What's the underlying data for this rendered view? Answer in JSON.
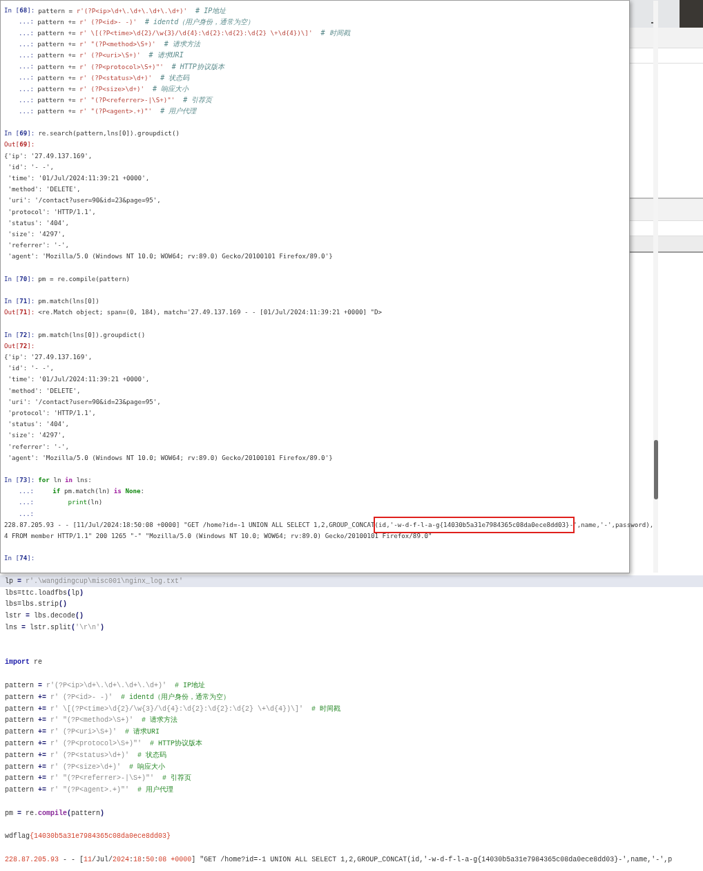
{
  "console": {
    "lines": [
      {
        "kind": "code",
        "prompt": {
          "kind": "in",
          "text": "In [**68**]:"
        },
        "segs": [
          {
            "kind": "plain",
            "text": "pattern = "
          },
          {
            "kind": "string",
            "text": "r'(?P<ip>\\d+\\.\\d+\\.\\d+\\.\\d+)'"
          },
          {
            "kind": "comment",
            "text": "  # IP地址"
          }
        ]
      },
      {
        "kind": "code",
        "prompt": {
          "kind": "cont",
          "text": "...:"
        },
        "segs": [
          {
            "kind": "plain",
            "text": "pattern += "
          },
          {
            "kind": "string",
            "text": "r' (?P<id>- -)'"
          },
          {
            "kind": "comment",
            "text": "  # identd（用户身份，通常为空）"
          }
        ]
      },
      {
        "kind": "code",
        "prompt": {
          "kind": "cont",
          "text": "...:"
        },
        "segs": [
          {
            "kind": "plain",
            "text": "pattern += "
          },
          {
            "kind": "string",
            "text": "r' \\[(?P<time>\\d{2}/\\w{3}/\\d{4}:\\d{2}:\\d{2}:\\d{2} \\+\\d{4})\\]'"
          },
          {
            "kind": "comment",
            "text": "  # 时间戳"
          }
        ]
      },
      {
        "kind": "code",
        "prompt": {
          "kind": "cont",
          "text": "...:"
        },
        "segs": [
          {
            "kind": "plain",
            "text": "pattern += "
          },
          {
            "kind": "string",
            "text": "r' \"(?P<method>\\S+)'"
          },
          {
            "kind": "comment",
            "text": "  # 请求方法"
          }
        ]
      },
      {
        "kind": "code",
        "prompt": {
          "kind": "cont",
          "text": "...:"
        },
        "segs": [
          {
            "kind": "plain",
            "text": "pattern += "
          },
          {
            "kind": "string",
            "text": "r' (?P<uri>\\S+)'"
          },
          {
            "kind": "comment",
            "text": "  # 请求URI"
          }
        ]
      },
      {
        "kind": "code",
        "prompt": {
          "kind": "cont",
          "text": "...:"
        },
        "segs": [
          {
            "kind": "plain",
            "text": "pattern += "
          },
          {
            "kind": "string",
            "text": "r' (?P<protocol>\\S+)\"'"
          },
          {
            "kind": "comment",
            "text": "  # HTTP协议版本"
          }
        ]
      },
      {
        "kind": "code",
        "prompt": {
          "kind": "cont",
          "text": "...:"
        },
        "segs": [
          {
            "kind": "plain",
            "text": "pattern += "
          },
          {
            "kind": "string",
            "text": "r' (?P<status>\\d+)'"
          },
          {
            "kind": "comment",
            "text": "  # 状态码"
          }
        ]
      },
      {
        "kind": "code",
        "prompt": {
          "kind": "cont",
          "text": "...:"
        },
        "segs": [
          {
            "kind": "plain",
            "text": "pattern += "
          },
          {
            "kind": "string",
            "text": "r' (?P<size>\\d+)'"
          },
          {
            "kind": "comment",
            "text": "  # 响应大小"
          }
        ]
      },
      {
        "kind": "code",
        "prompt": {
          "kind": "cont",
          "text": "...:"
        },
        "segs": [
          {
            "kind": "plain",
            "text": "pattern += "
          },
          {
            "kind": "string",
            "text": "r' \"(?P<referrer>-|\\S+)\"'"
          },
          {
            "kind": "comment",
            "text": "  # 引荐页"
          }
        ]
      },
      {
        "kind": "code",
        "prompt": {
          "kind": "cont",
          "text": "...:"
        },
        "segs": [
          {
            "kind": "plain",
            "text": "pattern += "
          },
          {
            "kind": "string",
            "text": "r' \"(?P<agent>.+)\"'"
          },
          {
            "kind": "comment",
            "text": "  # 用户代理"
          }
        ]
      },
      {
        "kind": "blank"
      },
      {
        "kind": "code",
        "prompt": {
          "kind": "in",
          "text": "In [**69**]:"
        },
        "segs": [
          {
            "kind": "plain",
            "text": "re.search(pattern,lns[0]).groupdict()"
          }
        ]
      },
      {
        "kind": "code",
        "prompt": {
          "kind": "out",
          "text": "Out[**69**]:"
        }
      },
      {
        "kind": "code",
        "segs": [
          {
            "kind": "plain",
            "text": "{'ip': '27.49.137.169',"
          }
        ]
      },
      {
        "kind": "code",
        "segs": [
          {
            "kind": "plain",
            "text": " 'id': '- -',"
          }
        ]
      },
      {
        "kind": "code",
        "segs": [
          {
            "kind": "plain",
            "text": " 'time': '01/Jul/2024:11:39:21 +0000',"
          }
        ]
      },
      {
        "kind": "code",
        "segs": [
          {
            "kind": "plain",
            "text": " 'method': 'DELETE',"
          }
        ]
      },
      {
        "kind": "code",
        "segs": [
          {
            "kind": "plain",
            "text": " 'uri': '/contact?user=90&id=23&page=95',"
          }
        ]
      },
      {
        "kind": "code",
        "segs": [
          {
            "kind": "plain",
            "text": " 'protocol': 'HTTP/1.1',"
          }
        ]
      },
      {
        "kind": "code",
        "segs": [
          {
            "kind": "plain",
            "text": " 'status': '404',"
          }
        ]
      },
      {
        "kind": "code",
        "segs": [
          {
            "kind": "plain",
            "text": " 'size': '4297',"
          }
        ]
      },
      {
        "kind": "code",
        "segs": [
          {
            "kind": "plain",
            "text": " 'referrer': '-',"
          }
        ]
      },
      {
        "kind": "code",
        "segs": [
          {
            "kind": "plain",
            "text": " 'agent': 'Mozilla/5.0 (Windows NT 10.0; WOW64; rv:89.0) Gecko/20100101 Firefox/89.0'}"
          }
        ]
      },
      {
        "kind": "blank"
      },
      {
        "kind": "code",
        "prompt": {
          "kind": "in",
          "text": "In [**70**]:"
        },
        "segs": [
          {
            "kind": "plain",
            "text": "pm = re.compile(pattern)"
          }
        ]
      },
      {
        "kind": "blank"
      },
      {
        "kind": "code",
        "prompt": {
          "kind": "in",
          "text": "In [**71**]:"
        },
        "segs": [
          {
            "kind": "plain",
            "text": "pm.match(lns[0])"
          }
        ]
      },
      {
        "kind": "code",
        "prompt": {
          "kind": "out",
          "text": "Out[**71**]:"
        },
        "segs": [
          {
            "kind": "plain",
            "text": "<re.Match object; span=(0, 184), match='27.49.137.169 - - [01/Jul/2024:11:39:21 +0000] \"D>"
          }
        ]
      },
      {
        "kind": "blank"
      },
      {
        "kind": "code",
        "prompt": {
          "kind": "in",
          "text": "In [**72**]:"
        },
        "segs": [
          {
            "kind": "plain",
            "text": "pm.match(lns[0]).groupdict()"
          }
        ]
      },
      {
        "kind": "code",
        "prompt": {
          "kind": "out",
          "text": "Out[**72**]:"
        }
      },
      {
        "kind": "code",
        "segs": [
          {
            "kind": "plain",
            "text": "{'ip': '27.49.137.169',"
          }
        ]
      },
      {
        "kind": "code",
        "segs": [
          {
            "kind": "plain",
            "text": " 'id': '- -',"
          }
        ]
      },
      {
        "kind": "code",
        "segs": [
          {
            "kind": "plain",
            "text": " 'time': '01/Jul/2024:11:39:21 +0000',"
          }
        ]
      },
      {
        "kind": "code",
        "segs": [
          {
            "kind": "plain",
            "text": " 'method': 'DELETE',"
          }
        ]
      },
      {
        "kind": "code",
        "segs": [
          {
            "kind": "plain",
            "text": " 'uri': '/contact?user=90&id=23&page=95',"
          }
        ]
      },
      {
        "kind": "code",
        "segs": [
          {
            "kind": "plain",
            "text": " 'protocol': 'HTTP/1.1',"
          }
        ]
      },
      {
        "kind": "code",
        "segs": [
          {
            "kind": "plain",
            "text": " 'status': '404',"
          }
        ]
      },
      {
        "kind": "code",
        "segs": [
          {
            "kind": "plain",
            "text": " 'size': '4297',"
          }
        ]
      },
      {
        "kind": "code",
        "segs": [
          {
            "kind": "plain",
            "text": " 'referrer': '-',"
          }
        ]
      },
      {
        "kind": "code",
        "segs": [
          {
            "kind": "plain",
            "text": " 'agent': 'Mozilla/5.0 (Windows NT 10.0; WOW64; rv:89.0) Gecko/20100101 Firefox/89.0'}"
          }
        ]
      },
      {
        "kind": "blank"
      },
      {
        "kind": "code",
        "prompt": {
          "kind": "in",
          "text": "In [**73**]:"
        },
        "segs": [
          {
            "kind": "keyword",
            "text": "for"
          },
          {
            "kind": "plain",
            "text": " ln "
          },
          {
            "kind": "keyword2",
            "text": "in"
          },
          {
            "kind": "plain",
            "text": " lns:"
          }
        ]
      },
      {
        "kind": "code",
        "prompt": {
          "kind": "cont",
          "text": "...:"
        },
        "segs": [
          {
            "kind": "keyword",
            "text": "    if"
          },
          {
            "kind": "plain",
            "text": " pm.match(ln) "
          },
          {
            "kind": "keyword2",
            "text": "is"
          },
          {
            "kind": "keyword",
            "text": " None"
          },
          {
            "kind": "plain",
            "text": ":"
          }
        ]
      },
      {
        "kind": "code",
        "prompt": {
          "kind": "cont",
          "text": "...:"
        },
        "segs": [
          {
            "kind": "builtin",
            "text": "        print"
          },
          {
            "kind": "plain",
            "text": "(ln)"
          }
        ]
      },
      {
        "kind": "code",
        "prompt": {
          "kind": "cont",
          "text": "...:"
        }
      },
      {
        "kind": "code",
        "segs": [
          {
            "kind": "plain",
            "text": "228.87.205.93 - - [11/Jul/2024:18:50:08 +0000] \"GET /home?id=-1 UNION ALL SELECT 1,2,GROUP_CONCAT"
          },
          {
            "kind": "highlight",
            "text": "(id,'-w-d-f-l-a-g{14030b5a31e7984365c08da0ece8dd03}-"
          },
          {
            "kind": "plain",
            "text": "',name,'-',password),"
          }
        ]
      },
      {
        "kind": "code",
        "segs": [
          {
            "kind": "plain",
            "text": "4 FROM member HTTP/1.1\" 200 1265 \"-\" \"Mozilla/5.0 (Windows NT 10.0; WOW64; rv:89.0) Gecko/20100101 Firefox/89.0\""
          }
        ]
      },
      {
        "kind": "blank"
      },
      {
        "kind": "code",
        "prompt": {
          "kind": "in",
          "text": "In [**74**]:"
        }
      }
    ]
  },
  "editor": {
    "lines": [
      {
        "kind": "code",
        "current": true,
        "segs": [
          {
            "kind": "plain",
            "text": "lp "
          },
          {
            "kind": "op",
            "text": "="
          },
          {
            "kind": "string",
            "text": " r'.\\wangdingcup\\misc001\\nginx_log.txt'"
          }
        ]
      },
      {
        "kind": "code",
        "current": false,
        "segs": [
          {
            "kind": "plain",
            "text": "lbs=ttc.loadfbs"
          },
          {
            "kind": "op",
            "text": "("
          },
          {
            "kind": "plain",
            "text": "lp"
          },
          {
            "kind": "op",
            "text": ")"
          }
        ]
      },
      {
        "kind": "code",
        "current": false,
        "segs": [
          {
            "kind": "plain",
            "text": "lbs=lbs.strip"
          },
          {
            "kind": "op",
            "text": "()"
          }
        ]
      },
      {
        "kind": "code",
        "current": false,
        "segs": [
          {
            "kind": "plain",
            "text": "lstr "
          },
          {
            "kind": "op",
            "text": "="
          },
          {
            "kind": "plain",
            "text": " lbs.decode"
          },
          {
            "kind": "op",
            "text": "()"
          }
        ]
      },
      {
        "kind": "code",
        "current": false,
        "segs": [
          {
            "kind": "plain",
            "text": "lns "
          },
          {
            "kind": "op",
            "text": "="
          },
          {
            "kind": "plain",
            "text": " lstr.split"
          },
          {
            "kind": "op",
            "text": "("
          },
          {
            "kind": "string",
            "text": "'\\r\\n'"
          },
          {
            "kind": "op",
            "text": ")"
          }
        ]
      },
      {
        "kind": "blank"
      },
      {
        "kind": "blank"
      },
      {
        "kind": "code",
        "current": false,
        "segs": [
          {
            "kind": "keyword",
            "text": "import"
          },
          {
            "kind": "plain",
            "text": " re"
          }
        ]
      },
      {
        "kind": "blank"
      },
      {
        "kind": "code",
        "current": false,
        "segs": [
          {
            "kind": "plain",
            "text": "pattern "
          },
          {
            "kind": "op",
            "text": "="
          },
          {
            "kind": "string",
            "text": " r'(?P<ip>\\d+\\.\\d+\\.\\d+\\.\\d+)'"
          },
          {
            "kind": "comment",
            "text": "  # IP地址"
          }
        ]
      },
      {
        "kind": "code",
        "current": false,
        "segs": [
          {
            "kind": "plain",
            "text": "pattern "
          },
          {
            "kind": "op",
            "text": "+="
          },
          {
            "kind": "string",
            "text": " r' (?P<id>- -)'"
          },
          {
            "kind": "comment",
            "text": "  # identd（用户身份，通常为空）"
          }
        ]
      },
      {
        "kind": "code",
        "current": false,
        "segs": [
          {
            "kind": "plain",
            "text": "pattern "
          },
          {
            "kind": "op",
            "text": "+="
          },
          {
            "kind": "string",
            "text": " r' \\[(?P<time>\\d{2}/\\w{3}/\\d{4}:\\d{2}:\\d{2}:\\d{2} \\+\\d{4})\\]'"
          },
          {
            "kind": "comment",
            "text": "  # 时间戳"
          }
        ]
      },
      {
        "kind": "code",
        "current": false,
        "segs": [
          {
            "kind": "plain",
            "text": "pattern "
          },
          {
            "kind": "op",
            "text": "+="
          },
          {
            "kind": "string",
            "text": " r' \"(?P<method>\\S+)'"
          },
          {
            "kind": "comment",
            "text": "  # 请求方法"
          }
        ]
      },
      {
        "kind": "code",
        "current": false,
        "segs": [
          {
            "kind": "plain",
            "text": "pattern "
          },
          {
            "kind": "op",
            "text": "+="
          },
          {
            "kind": "string",
            "text": " r' (?P<uri>\\S+)'"
          },
          {
            "kind": "comment",
            "text": "  # 请求URI"
          }
        ]
      },
      {
        "kind": "code",
        "current": false,
        "segs": [
          {
            "kind": "plain",
            "text": "pattern "
          },
          {
            "kind": "op",
            "text": "+="
          },
          {
            "kind": "string",
            "text": " r' (?P<protocol>\\S+)\"'"
          },
          {
            "kind": "comment",
            "text": "  # HTTP协议版本"
          }
        ]
      },
      {
        "kind": "code",
        "current": false,
        "segs": [
          {
            "kind": "plain",
            "text": "pattern "
          },
          {
            "kind": "op",
            "text": "+="
          },
          {
            "kind": "string",
            "text": " r' (?P<status>\\d+)'"
          },
          {
            "kind": "comment",
            "text": "  # 状态码"
          }
        ]
      },
      {
        "kind": "code",
        "current": false,
        "segs": [
          {
            "kind": "plain",
            "text": "pattern "
          },
          {
            "kind": "op",
            "text": "+="
          },
          {
            "kind": "string",
            "text": " r' (?P<size>\\d+)'"
          },
          {
            "kind": "comment",
            "text": "  # 响应大小"
          }
        ]
      },
      {
        "kind": "code",
        "current": false,
        "segs": [
          {
            "kind": "plain",
            "text": "pattern "
          },
          {
            "kind": "op",
            "text": "+="
          },
          {
            "kind": "string",
            "text": " r' \"(?P<referrer>-|\\S+)\"'"
          },
          {
            "kind": "comment",
            "text": "  # 引荐页"
          }
        ]
      },
      {
        "kind": "code",
        "current": false,
        "segs": [
          {
            "kind": "plain",
            "text": "pattern "
          },
          {
            "kind": "op",
            "text": "+="
          },
          {
            "kind": "string",
            "text": " r' \"(?P<agent>.+)\"'"
          },
          {
            "kind": "comment",
            "text": "  # 用户代理"
          }
        ]
      },
      {
        "kind": "blank"
      },
      {
        "kind": "code",
        "current": false,
        "segs": [
          {
            "kind": "plain",
            "text": "pm "
          },
          {
            "kind": "op",
            "text": "="
          },
          {
            "kind": "plain",
            "text": " re."
          },
          {
            "kind": "method",
            "text": "compile"
          },
          {
            "kind": "op",
            "text": "("
          },
          {
            "kind": "plain",
            "text": "pattern"
          },
          {
            "kind": "op",
            "text": ")"
          }
        ]
      },
      {
        "kind": "blank"
      },
      {
        "kind": "code",
        "current": false,
        "segs": [
          {
            "kind": "plain",
            "text": "wdflag"
          },
          {
            "kind": "number",
            "text": "{14030b5a31e7984365c08da0ece8dd03}"
          }
        ]
      },
      {
        "kind": "blank"
      },
      {
        "kind": "code",
        "current": false,
        "segs": [
          {
            "kind": "number",
            "text": "228.87.205.93"
          },
          {
            "kind": "plain",
            "text": " - - ["
          },
          {
            "kind": "number",
            "text": "11"
          },
          {
            "kind": "plain",
            "text": "/Jul/"
          },
          {
            "kind": "number",
            "text": "2024"
          },
          {
            "kind": "plain",
            "text": ":"
          },
          {
            "kind": "number",
            "text": "18"
          },
          {
            "kind": "plain",
            "text": ":"
          },
          {
            "kind": "number",
            "text": "50"
          },
          {
            "kind": "plain",
            "text": ":"
          },
          {
            "kind": "number",
            "text": "08"
          },
          {
            "kind": "number",
            "text": " +0000"
          },
          {
            "kind": "plain",
            "text": "] \"GET /home?id=-1 UNION ALL SELECT 1,2,GROUP_CONCAT(id,'-w-d-f-l-a-g{14030b5a31e7984365c08da0ece8dd03}-',name,'-',p"
          }
        ]
      }
    ]
  }
}
